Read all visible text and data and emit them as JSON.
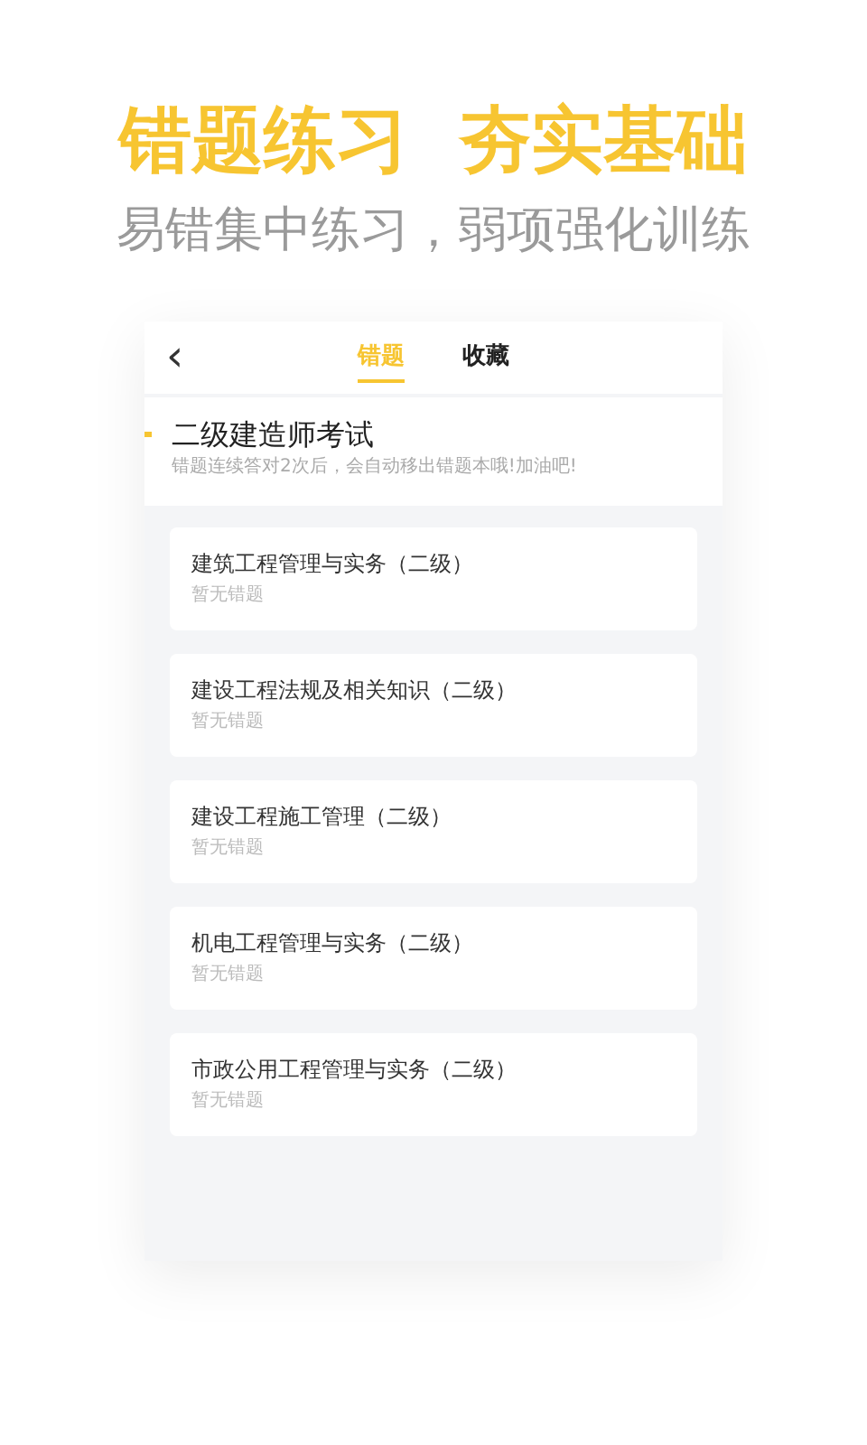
{
  "headline": "错题练习  夯实基础",
  "subheadline": "易错集中练习，弱项强化训练",
  "app": {
    "back": "‹",
    "tabs": [
      {
        "label": "错题",
        "selected": true
      },
      {
        "label": "收藏",
        "selected": false
      }
    ],
    "exam_title": "二级建造师考试",
    "note": "错题连续答对2次后，会自动移出错题本哦!加油吧!",
    "subjects": [
      {
        "name": "建筑工程管理与实务（二级）",
        "status": "暂无错题"
      },
      {
        "name": "建设工程法规及相关知识（二级）",
        "status": "暂无错题"
      },
      {
        "name": "建设工程施工管理（二级）",
        "status": "暂无错题"
      },
      {
        "name": "机电工程管理与实务（二级）",
        "status": "暂无错题"
      },
      {
        "name": "市政公用工程管理与实务（二级）",
        "status": "暂无错题"
      }
    ]
  }
}
